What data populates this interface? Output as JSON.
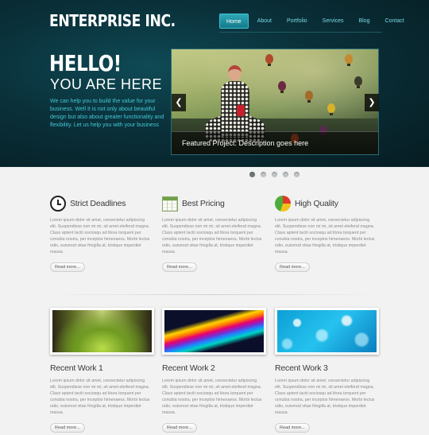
{
  "header": {
    "logo": "ENTERPRISE INC.",
    "nav": [
      "Home",
      "About",
      "Portfolio",
      "Services",
      "Blog",
      "Contact"
    ],
    "active_nav": "Home"
  },
  "hero": {
    "title": "HELLO!",
    "subtitle": "YOU ARE HERE",
    "intro": "We can help you to build the value for your business. Well It is not only about beautiful design but also about greater functionality and flexibility. Let us help you with your business"
  },
  "slider": {
    "caption": "Featured Project: Description goes here",
    "prev_icon": "chevron-left-icon",
    "next_icon": "chevron-right-icon",
    "prev_glyph": "❮",
    "next_glyph": "❯",
    "dots_count": 5,
    "active_dot": 0
  },
  "features": [
    {
      "icon": "clock-icon",
      "title": "Strict Deadlines",
      "text": "Lorem ipsum dolor sit amet, consectetur adipiscing elit. Suspendisse non mi mi, sit amet eleifend magna. Class aptent taciti sociosqu ad litora torquent per conubia nostra, per inceptos himenaeos. Morbi lectus odio, euismod vitae fringilla at, tristique imperdiet massa.",
      "button": "Read more..."
    },
    {
      "icon": "spreadsheet-icon",
      "title": "Best Pricing",
      "text": "Lorem ipsum dolor sit amet, consectetur adipiscing elit. Suspendisse non mi mi, sit amet eleifend magna. Class aptent taciti sociosqu ad litora torquent per conubia nostra, per inceptos himenaeos. Morbi lectus odio, euismod vitae fringilla at, tristique imperdiet massa.",
      "button": "Read more..."
    },
    {
      "icon": "pie-chart-icon",
      "title": "High Quality",
      "text": "Lorem ipsum dolor sit amet, consectetur adipiscing elit. Suspendisse non mi mi, sit amet eleifend magna. Class aptent taciti sociosqu ad litora torquent per conubia nostra, per inceptos himenaeos. Morbi lectus odio, euismod vitae fringilla at, tristique imperdiet massa.",
      "button": "Read more..."
    }
  ],
  "works": [
    {
      "title": "Recent Work 1",
      "text": "Lorem ipsum dolor sit amet, consectetur adipiscing elit. Suspendisse non mi mi, sit amet eleifend magna. Class aptent taciti sociosqu ad litora torquent per conubia nostra, per inceptos himenaeos. Morbi lectus odio, euismod vitae fringilla at, tristique imperdiet massa.",
      "button": "Read more..."
    },
    {
      "title": "Recent Work 2",
      "text": "Lorem ipsum dolor sit amet, consectetur adipiscing elit. Suspendisse non mi mi, sit amet eleifend magna. Class aptent taciti sociosqu ad litora torquent per conubia nostra, per inceptos himenaeos. Morbi lectus odio, euismod vitae fringilla at, tristique imperdiet massa.",
      "button": "Read more..."
    },
    {
      "title": "Recent Work 3",
      "text": "Lorem ipsum dolor sit amet, consectetur adipiscing elit. Suspendisse non mi mi, sit amet eleifend magna. Class aptent taciti sociosqu ad litora torquent per conubia nostra, per inceptos himenaeos. Morbi lectus odio, euismod vitae fringilla at, tristique imperdiet massa.",
      "button": "Read more..."
    }
  ],
  "colors": {
    "accent": "#2fa8b8",
    "nav_text": "#7ad9e4",
    "intro_text": "#43c9d8",
    "hero_bg": "#0a3039"
  }
}
